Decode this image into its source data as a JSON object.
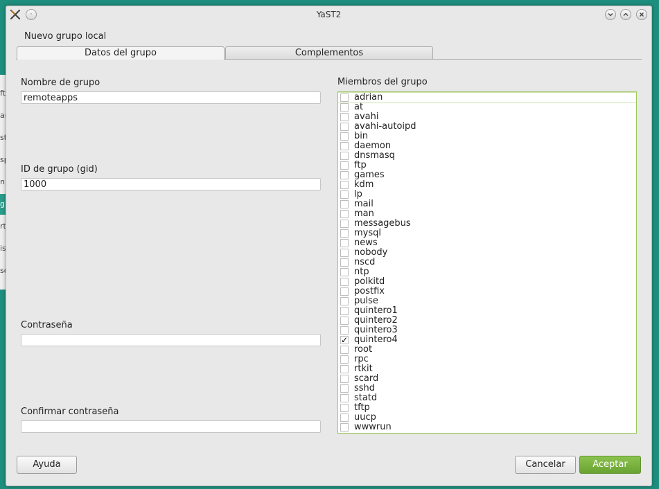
{
  "window": {
    "title": "YaST2",
    "app_icon": "yast-x-icon",
    "controls": [
      "minimize-icon",
      "maximize-icon",
      "close-icon"
    ]
  },
  "background_window": {
    "fragments": [
      "ft",
      "ar",
      "st",
      "sp",
      "n",
      "g",
      "rt",
      "is",
      "so"
    ]
  },
  "dialog": {
    "heading": "Nuevo grupo local",
    "tabs": [
      {
        "label": "Datos del grupo",
        "active": true
      },
      {
        "label": "Complementos",
        "active": false
      }
    ]
  },
  "form": {
    "group_name": {
      "label": "Nombre de grupo",
      "value": "remoteapps"
    },
    "gid": {
      "label": "ID de grupo (gid)",
      "value": "1000"
    },
    "password": {
      "label": "Contraseña",
      "value": ""
    },
    "confirm_password": {
      "label": "Confirmar contraseña",
      "value": ""
    }
  },
  "members": {
    "label": "Miembros del grupo",
    "items": [
      {
        "name": "adrian",
        "checked": false
      },
      {
        "name": "at",
        "checked": false
      },
      {
        "name": "avahi",
        "checked": false
      },
      {
        "name": "avahi-autoipd",
        "checked": false
      },
      {
        "name": "bin",
        "checked": false
      },
      {
        "name": "daemon",
        "checked": false
      },
      {
        "name": "dnsmasq",
        "checked": false
      },
      {
        "name": "ftp",
        "checked": false
      },
      {
        "name": "games",
        "checked": false
      },
      {
        "name": "kdm",
        "checked": false
      },
      {
        "name": "lp",
        "checked": false
      },
      {
        "name": "mail",
        "checked": false
      },
      {
        "name": "man",
        "checked": false
      },
      {
        "name": "messagebus",
        "checked": false
      },
      {
        "name": "mysql",
        "checked": false
      },
      {
        "name": "news",
        "checked": false
      },
      {
        "name": "nobody",
        "checked": false
      },
      {
        "name": "nscd",
        "checked": false
      },
      {
        "name": "ntp",
        "checked": false
      },
      {
        "name": "polkitd",
        "checked": false
      },
      {
        "name": "postfix",
        "checked": false
      },
      {
        "name": "pulse",
        "checked": false
      },
      {
        "name": "quintero1",
        "checked": false
      },
      {
        "name": "quintero2",
        "checked": false
      },
      {
        "name": "quintero3",
        "checked": false
      },
      {
        "name": "quintero4",
        "checked": true
      },
      {
        "name": "root",
        "checked": false
      },
      {
        "name": "rpc",
        "checked": false
      },
      {
        "name": "rtkit",
        "checked": false
      },
      {
        "name": "scard",
        "checked": false
      },
      {
        "name": "sshd",
        "checked": false
      },
      {
        "name": "statd",
        "checked": false
      },
      {
        "name": "tftp",
        "checked": false
      },
      {
        "name": "uucp",
        "checked": false
      },
      {
        "name": "wwwrun",
        "checked": false
      }
    ]
  },
  "buttons": {
    "help": "Ayuda",
    "cancel": "Cancelar",
    "accept": "Aceptar"
  },
  "colors": {
    "desktop": "#1e8f7e",
    "accent_green": "#7ab43f",
    "list_border": "#9cc85c"
  }
}
